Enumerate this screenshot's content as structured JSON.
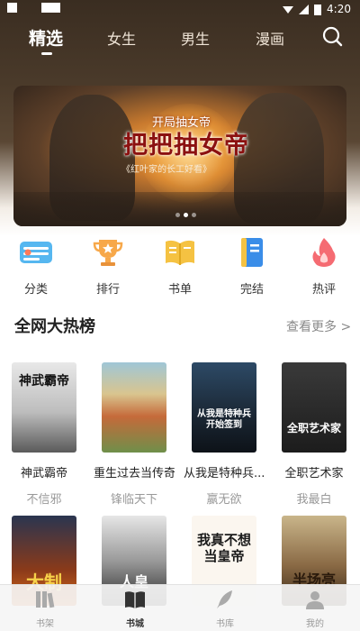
{
  "status_bar": {
    "time": "4:20"
  },
  "top_nav": {
    "tabs": [
      "精选",
      "女生",
      "男生",
      "漫画"
    ]
  },
  "banner": {
    "title_small": "开局抽女帝",
    "title_big": "把把抽女帝",
    "subtitle": "《红叶家的长工好看》"
  },
  "categories": [
    "分类",
    "排行",
    "书单",
    "完结",
    "热评"
  ],
  "section": {
    "title": "全网大热榜",
    "more": "查看更多 >"
  },
  "books_row1": [
    {
      "name": "神武霸帝",
      "author": "不信邪",
      "cover_text": "神武霸帝"
    },
    {
      "name": "重生过去当传奇",
      "author": "锋临天下",
      "cover_text": ""
    },
    {
      "name": "从我是特种兵...",
      "author": "嬴无欲",
      "cover_text": "从我是特种兵开始签到"
    },
    {
      "name": "全职艺术家",
      "author": "我最白",
      "cover_text": "全职艺术家"
    }
  ],
  "books_row2_covers": [
    "大制",
    "人皇",
    "我真不想当皇帝",
    "半场亮"
  ],
  "bottom_nav": [
    "书架",
    "书城",
    "书库",
    "我的"
  ],
  "colors": {
    "accent_text": "#222222",
    "muted": "#999999",
    "nav_bg": "#4a3a2a"
  }
}
